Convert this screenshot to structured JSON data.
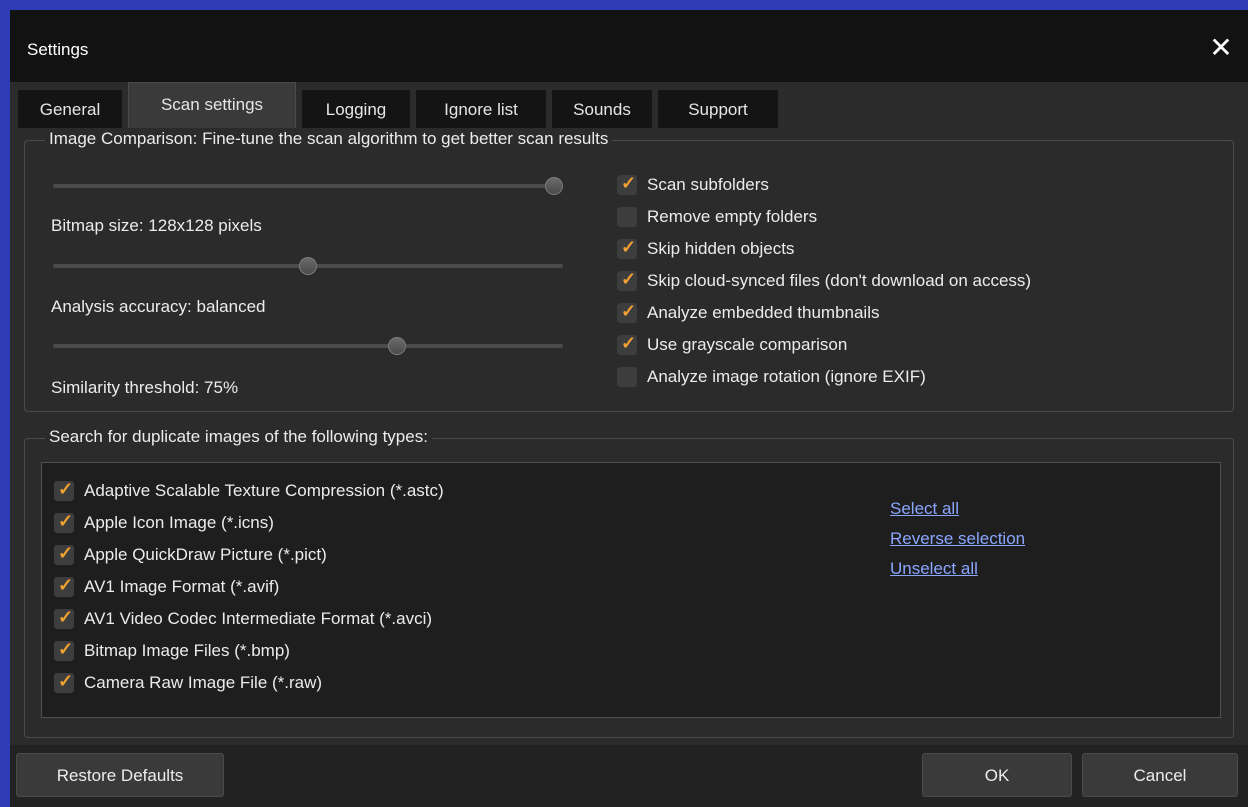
{
  "window": {
    "title": "Settings"
  },
  "tabs": [
    "General",
    "Scan settings",
    "Logging",
    "Ignore list",
    "Sounds",
    "Support"
  ],
  "active_tab": "Scan settings",
  "image_comparison": {
    "legend": "Image Comparison: Fine-tune the scan algorithm to get better scan results",
    "sliders": [
      {
        "label": "Bitmap size: 128x128 pixels",
        "value": 1.0
      },
      {
        "label": "Analysis accuracy: balanced",
        "value": 0.5
      },
      {
        "label": "Similarity threshold: 75%",
        "value": 0.68
      }
    ],
    "options": [
      {
        "label": "Scan subfolders",
        "checked": true
      },
      {
        "label": "Remove empty folders",
        "checked": false
      },
      {
        "label": "Skip hidden objects",
        "checked": true
      },
      {
        "label": "Skip cloud-synced files (don't download on access)",
        "checked": true
      },
      {
        "label": "Analyze embedded thumbnails",
        "checked": true
      },
      {
        "label": "Use grayscale comparison",
        "checked": true
      },
      {
        "label": "Analyze image rotation (ignore EXIF)",
        "checked": false
      }
    ]
  },
  "file_types": {
    "legend": "Search for duplicate images of the following types:",
    "items": [
      {
        "label": "Adaptive Scalable Texture Compression (*.astc)",
        "checked": true
      },
      {
        "label": "Apple Icon Image (*.icns)",
        "checked": true
      },
      {
        "label": "Apple QuickDraw Picture (*.pict)",
        "checked": true
      },
      {
        "label": "AV1 Image Format (*.avif)",
        "checked": true
      },
      {
        "label": "AV1 Video Codec Intermediate Format (*.avci)",
        "checked": true
      },
      {
        "label": "Bitmap Image Files (*.bmp)",
        "checked": true
      },
      {
        "label": "Camera Raw Image File (*.raw)",
        "checked": true
      }
    ],
    "links": [
      "Select all",
      "Reverse selection",
      "Unselect all"
    ]
  },
  "buttons": {
    "restore": "Restore Defaults",
    "ok": "OK",
    "cancel": "Cancel"
  },
  "check_glyph": "✓",
  "colors": {
    "accent_check": "#f0a030",
    "link": "#8aa6ff",
    "outer_border": "#2d3bb4"
  }
}
